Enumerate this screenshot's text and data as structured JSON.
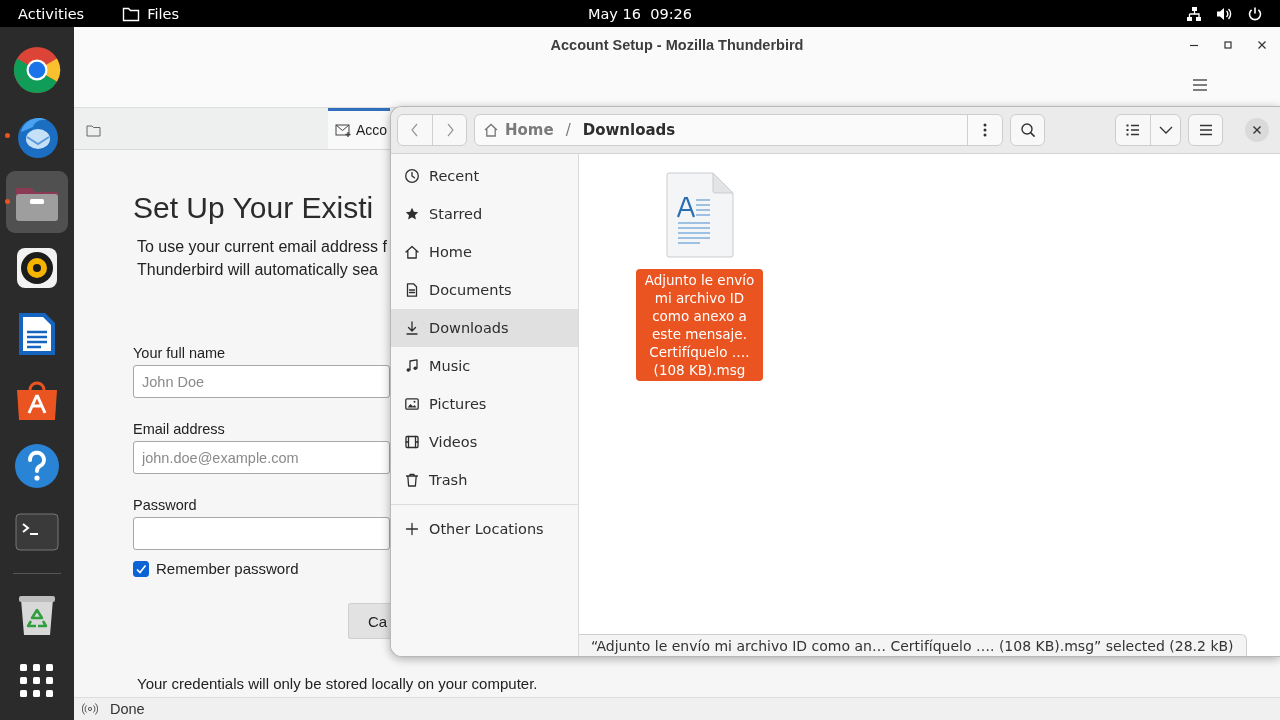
{
  "top_bar": {
    "activities": "Activities",
    "app_name": "Files",
    "clock": "May 16  09:26"
  },
  "dock": [
    {
      "kind": "browser",
      "running": false,
      "focused": false
    },
    {
      "kind": "mail",
      "running": true,
      "focused": false
    },
    {
      "kind": "files",
      "running": true,
      "focused": true
    },
    {
      "kind": "music",
      "running": false,
      "focused": false
    },
    {
      "kind": "writer",
      "running": false,
      "focused": false
    },
    {
      "kind": "store",
      "running": false,
      "focused": false
    },
    {
      "kind": "help",
      "running": false,
      "focused": false
    },
    {
      "kind": "terminal",
      "running": false,
      "focused": false
    },
    {
      "kind": "trash",
      "running": false,
      "focused": false
    },
    {
      "kind": "apps",
      "running": false,
      "focused": false
    }
  ],
  "thunderbird": {
    "title": "Account Setup - Mozilla Thunderbird",
    "tabs": [
      {
        "kind": "home",
        "selected": false
      },
      {
        "kind": "account",
        "label": "Acco",
        "selected": true
      }
    ],
    "heading": "Set Up Your Existi",
    "intro": [
      "To use your current email address f",
      "Thunderbird will automatically sea"
    ],
    "fields": [
      {
        "label": "Your full name",
        "placeholder": "John Doe"
      },
      {
        "label": "Email address",
        "placeholder": "john.doe@example.com"
      },
      {
        "label": "Password"
      }
    ],
    "remember": {
      "label": "Remember password",
      "checked": true
    },
    "button": "Ca",
    "footer": "Your credentials will only be stored locally on your computer.",
    "status": "Done"
  },
  "files": {
    "path": [
      {
        "kind": "home",
        "label": "Home"
      },
      {
        "kind": "folder",
        "label": "Downloads"
      }
    ],
    "path_separator": "/",
    "sidebar": [
      {
        "kind": "recent",
        "label": "Recent",
        "selected": false
      },
      {
        "kind": "starred",
        "label": "Starred",
        "selected": false
      },
      {
        "kind": "home",
        "label": "Home",
        "selected": false
      },
      {
        "kind": "documents",
        "label": "Documents",
        "selected": false
      },
      {
        "kind": "downloads",
        "label": "Downloads",
        "selected": true
      },
      {
        "kind": "music",
        "label": "Music",
        "selected": false
      },
      {
        "kind": "pictures",
        "label": "Pictures",
        "selected": false
      },
      {
        "kind": "videos",
        "label": "Videos",
        "selected": false
      },
      {
        "kind": "trash",
        "label": "Trash",
        "selected": false
      },
      {
        "kind": "other",
        "label": "Other Locations",
        "selected": false
      }
    ],
    "items": [
      {
        "name": "Adjunto le envío mi archivo ID como anexo a este mensaje. Certifíquelo …. (108 KB).msg",
        "selected": true
      }
    ],
    "status": "“Adjunto le envío mi archivo ID como an… Certifíquelo …. (108 KB).msg” selected (28.2 kB)"
  }
}
